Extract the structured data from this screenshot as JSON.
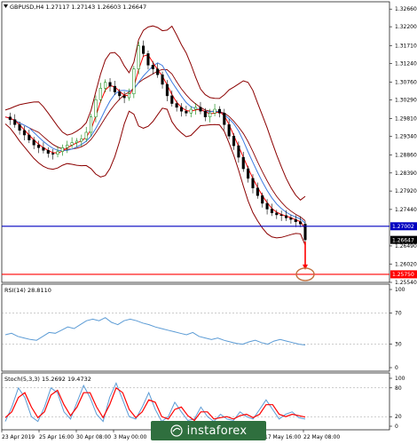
{
  "chart_data": [
    {
      "type": "candlestick",
      "title": "GBPUSD,H4  1.27117 1.27143 1.26603 1.26647",
      "ylim": [
        1.2554,
        1.3285
      ],
      "y_ticks": [
        "1.32660",
        "1.32200",
        "1.31710",
        "1.31240",
        "1.30760",
        "1.30290",
        "1.29810",
        "1.29340",
        "1.28860",
        "1.28390",
        "1.27920",
        "1.27440",
        "1.26490",
        "1.26020",
        "1.25540"
      ],
      "price_labels": {
        "blue_line": "1.27002",
        "current_price": "1.26647",
        "red_line": "1.25750"
      },
      "blue_line_value": 1.27002,
      "red_line_value": 1.2575,
      "current_value": 1.26647,
      "x_labels": [
        "23 Apr 2019",
        "25 Apr 16:00",
        "30 Apr 08:00",
        "3 May 00:00",
        "17 May 16:00",
        "22 May 08:00"
      ],
      "close_path": [
        1.2985,
        1.2978,
        1.2965,
        1.295,
        1.2938,
        1.2925,
        1.2912,
        1.2905,
        1.2898,
        1.289,
        1.2888,
        1.2895,
        1.2905,
        1.2912,
        1.2918,
        1.2922,
        1.2928,
        1.2945,
        1.2985,
        1.303,
        1.306,
        1.3075,
        1.3065,
        1.305,
        1.304,
        1.3035,
        1.3045,
        1.311,
        1.317,
        1.315,
        1.312,
        1.311,
        1.3095,
        1.307,
        1.304,
        1.302,
        1.301,
        1.3,
        1.2995,
        1.3005,
        1.301,
        1.3,
        1.2985,
        1.2995,
        1.3005,
        1.2995,
        1.2965,
        1.2935,
        1.291,
        1.288,
        1.285,
        1.2825,
        1.28,
        1.278,
        1.276,
        1.2745,
        1.2735,
        1.273,
        1.2728,
        1.2722,
        1.2718,
        1.2712,
        1.2706,
        1.2665
      ],
      "rsi": {
        "label": "RSI(14) 28.8110",
        "ylim": [
          0,
          100
        ],
        "y_ticks": [
          "100",
          "70",
          "30",
          "0"
        ],
        "values": [
          42,
          44,
          40,
          38,
          36,
          35,
          40,
          45,
          44,
          48,
          52,
          50,
          55,
          60,
          62,
          60,
          64,
          58,
          55,
          60,
          62,
          60,
          57,
          55,
          52,
          50,
          48,
          46,
          44,
          42,
          45,
          40,
          38,
          36,
          38,
          35,
          33,
          31,
          30,
          33,
          35,
          32,
          30,
          34,
          36,
          34,
          32,
          30,
          29
        ]
      },
      "stoch": {
        "label": "Stoch(5,3,3) 15.2692 19.4732",
        "ylim": [
          0,
          100
        ],
        "y_ticks": [
          "100",
          "80",
          "20",
          "0"
        ],
        "main": [
          10,
          40,
          80,
          60,
          20,
          10,
          40,
          80,
          70,
          30,
          15,
          50,
          85,
          60,
          25,
          10,
          60,
          90,
          55,
          20,
          15,
          40,
          70,
          35,
          10,
          20,
          50,
          30,
          12,
          15,
          40,
          20,
          10,
          25,
          15,
          12,
          30,
          20,
          15,
          35,
          55,
          35,
          15,
          25,
          30,
          18,
          15
        ],
        "signal": [
          18,
          30,
          60,
          70,
          40,
          18,
          30,
          65,
          75,
          45,
          22,
          40,
          70,
          70,
          40,
          18,
          45,
          80,
          70,
          35,
          18,
          30,
          55,
          50,
          20,
          15,
          35,
          40,
          22,
          12,
          30,
          30,
          15,
          18,
          20,
          15,
          22,
          25,
          18,
          25,
          45,
          45,
          25,
          20,
          25,
          22,
          19
        ]
      }
    }
  ],
  "watermark_text": "instaforex",
  "colors": {
    "bull": "#008000",
    "bear": "#000000",
    "bands": "#8b0000",
    "ma_blue": "#3e7be0",
    "ma_red": "#ff0000",
    "blue_line": "#0000c0",
    "red_line": "#ff0000",
    "rsi_line": "#5b9bd5",
    "stoch_main": "#5b9bd5",
    "stoch_signal": "#ff0000",
    "circle": "#c0703f"
  }
}
